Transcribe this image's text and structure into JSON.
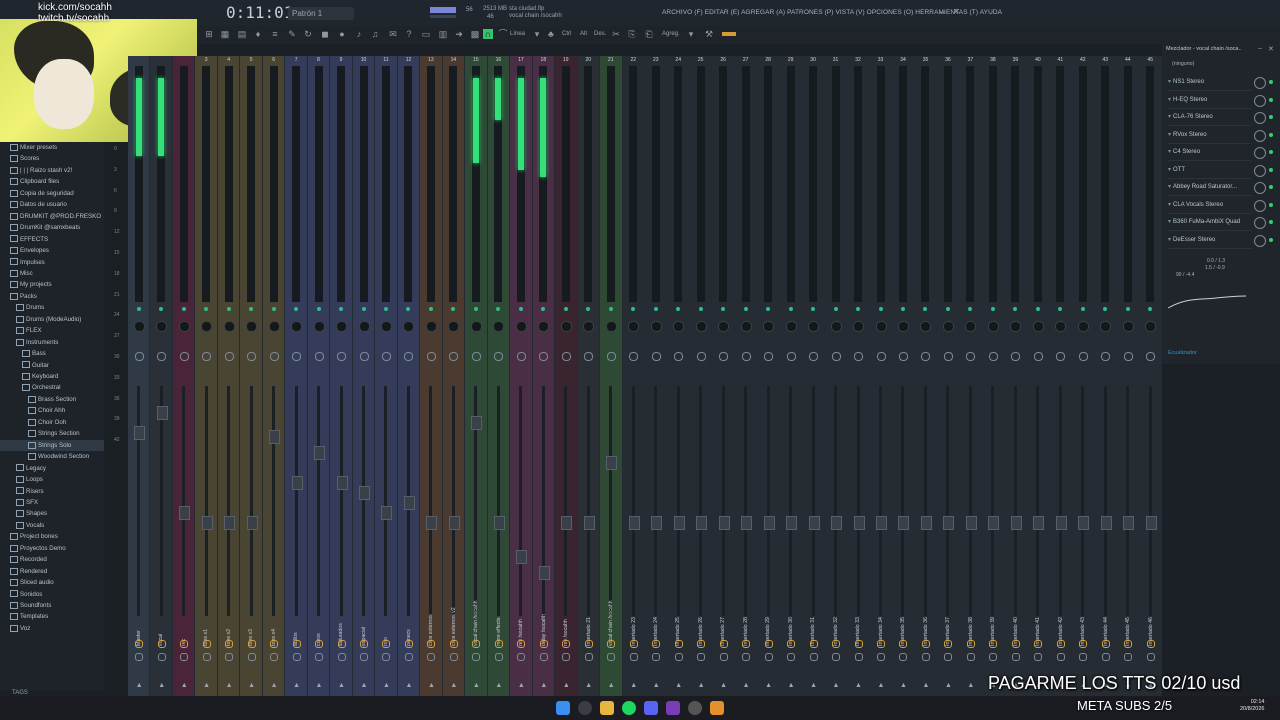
{
  "stream": {
    "kick_url": "kick.com/socahh",
    "twitch_url": "twitch.tv/socahh",
    "tts_banner": "PAGARME LOS TTS 02/10 usd",
    "subs_banner": "META SUBS 2/5"
  },
  "topbar": {
    "time": "0:11:01",
    "pattern": "Patrón 1",
    "tempo": "56",
    "memory": "2513 MB",
    "cpu": "46",
    "project_file": "sta ciudad.flp",
    "project_mixer": "vocal chain /socahh",
    "menu": "ARCHIVO (F) EDITAR (E) AGREGAR (A) PATRONES (P) VISTA (V) OPCIONES (O) HERRAMIENTAS (T) AYUDA",
    "linea_label": "Línea",
    "agreg_label": "Agreg.",
    "ctrl_label": "Ctrl",
    "alt_label": "Alt",
    "des_label": "Des."
  },
  "browser": {
    "items": [
      {
        "label": "Mixer presets",
        "indent": 1
      },
      {
        "label": "Scores",
        "indent": 1
      },
      {
        "label": "| | | Raizo stash v2!",
        "indent": 1
      },
      {
        "label": "Clipboard files",
        "indent": 1
      },
      {
        "label": "Copia de seguridad",
        "indent": 1
      },
      {
        "label": "Datos de usuario",
        "indent": 1
      },
      {
        "label": "DRUMKIT @PROD.FRESKO",
        "indent": 1
      },
      {
        "label": "DrumKit @samxbeats",
        "indent": 1
      },
      {
        "label": "EFFECTS",
        "indent": 1
      },
      {
        "label": "Envelopes",
        "indent": 1
      },
      {
        "label": "Impulses",
        "indent": 1
      },
      {
        "label": "Misc",
        "indent": 1
      },
      {
        "label": "My projects",
        "indent": 1
      },
      {
        "label": "Packs",
        "indent": 1
      },
      {
        "label": "Drums",
        "indent": 2
      },
      {
        "label": "Drums (ModeAudio)",
        "indent": 2
      },
      {
        "label": "FLEX",
        "indent": 2
      },
      {
        "label": "Instruments",
        "indent": 2
      },
      {
        "label": "Bass",
        "indent": 3
      },
      {
        "label": "Guitar",
        "indent": 3
      },
      {
        "label": "Keyboard",
        "indent": 3
      },
      {
        "label": "Orchestral",
        "indent": 3
      },
      {
        "label": "Brass Section",
        "indent": 4
      },
      {
        "label": "Choir Ahh",
        "indent": 4
      },
      {
        "label": "Choir Ooh",
        "indent": 4
      },
      {
        "label": "Strings Section",
        "indent": 4
      },
      {
        "label": "Strings Solo",
        "indent": 4
      },
      {
        "label": "Woodwind Section",
        "indent": 4
      },
      {
        "label": "Legacy",
        "indent": 2
      },
      {
        "label": "Loops",
        "indent": 2
      },
      {
        "label": "Risers",
        "indent": 2
      },
      {
        "label": "SFX",
        "indent": 2
      },
      {
        "label": "Shapes",
        "indent": 2
      },
      {
        "label": "Vocals",
        "indent": 2
      },
      {
        "label": "Project bones",
        "indent": 1
      },
      {
        "label": "Proyectos Demo",
        "indent": 1
      },
      {
        "label": "Recorded",
        "indent": 1
      },
      {
        "label": "Rendered",
        "indent": 1
      },
      {
        "label": "Sliced audio",
        "indent": 1
      },
      {
        "label": "Sonidos",
        "indent": 1
      },
      {
        "label": "Soundfonts",
        "indent": 1
      },
      {
        "label": "Templates",
        "indent": 1
      },
      {
        "label": "Voz",
        "indent": 1
      }
    ],
    "tag": "TAGS"
  },
  "scale": [
    "0",
    "3",
    "6",
    "9",
    "12",
    "15",
    "18",
    "21",
    "24",
    "27",
    "30",
    "33",
    "36",
    "39",
    "42"
  ],
  "mixer": {
    "strips": [
      {
        "num": "",
        "name": "Master",
        "color": "#2f3a46",
        "level": 0.55,
        "fader": 0.2
      },
      {
        "num": "",
        "name": "vocal",
        "color": "#2a3037",
        "level": 0.55,
        "fader": 0.1
      },
      {
        "num": "",
        "name": "rec",
        "color": "#4a2438",
        "level": 0.0,
        "fader": 0.6
      },
      {
        "num": "3",
        "name": "tone x1",
        "color": "#4a4433",
        "level": 0,
        "fader": 0.65
      },
      {
        "num": "4",
        "name": "tone x2",
        "color": "#4a4433",
        "level": 0,
        "fader": 0.65
      },
      {
        "num": "5",
        "name": "tone x3",
        "color": "#4a4433",
        "level": 0,
        "fader": 0.65
      },
      {
        "num": "6",
        "name": "tone x4",
        "color": "#4a4433",
        "level": 0,
        "fader": 0.22
      },
      {
        "num": "7",
        "name": "adlibs",
        "color": "#353c5a",
        "level": 0,
        "fader": 0.45
      },
      {
        "num": "8",
        "name": "coros",
        "color": "#353c5a",
        "level": 0,
        "fader": 0.3
      },
      {
        "num": "9",
        "name": "saturados",
        "color": "#353c5a",
        "level": 0,
        "fader": 0.45
      },
      {
        "num": "10",
        "name": "espacial",
        "color": "#353c5a",
        "level": 0,
        "fader": 0.5
      },
      {
        "num": "11",
        "name": "roto",
        "color": "#353c5a",
        "level": 0,
        "fader": 0.6
      },
      {
        "num": "12",
        "name": "panecs",
        "color": "#353c5a",
        "level": 0,
        "fader": 0.55
      },
      {
        "num": "13",
        "name": "clips externos",
        "color": "#4a3a30",
        "level": 0,
        "fader": 0.65
      },
      {
        "num": "14",
        "name": "clips externos v2",
        "color": "#4a3a30",
        "level": 0,
        "fader": 0.65
      },
      {
        "num": "15",
        "name": "vocal chain /socahh",
        "color": "#2e4a36",
        "level": 0.6,
        "fader": 0.15
      },
      {
        "num": "16",
        "name": "more effects",
        "color": "#2e4a36",
        "level": 0.3,
        "fader": 0.65
      },
      {
        "num": "17",
        "name": "rev /socahh",
        "color": "#4a2e46",
        "level": 0.65,
        "fader": 0.82
      },
      {
        "num": "18",
        "name": "delay /socahh",
        "color": "#4a2e46",
        "level": 0.7,
        "fader": 0.9
      },
      {
        "num": "19",
        "name": "rev /socahh",
        "color": "#3a2430",
        "level": 0,
        "fader": 0.65
      },
      {
        "num": "20",
        "name": "Insertado 21",
        "color": "#2a2f36",
        "level": 0,
        "fader": 0.65
      },
      {
        "num": "21",
        "name": "vocal chain /socahh",
        "color": "#2f4a34",
        "level": 0,
        "fader": 0.35
      },
      {
        "num": "22",
        "name": "Insertado 23",
        "color": "#262c33",
        "level": 0,
        "fader": 0.65
      },
      {
        "num": "23",
        "name": "Insertado 24",
        "color": "#262c33",
        "level": 0,
        "fader": 0.65
      },
      {
        "num": "24",
        "name": "Insertado 25",
        "color": "#262c33",
        "level": 0,
        "fader": 0.65
      },
      {
        "num": "25",
        "name": "Insertado 26",
        "color": "#262c33",
        "level": 0,
        "fader": 0.65
      },
      {
        "num": "26",
        "name": "Insertado 27",
        "color": "#262c33",
        "level": 0,
        "fader": 0.65
      },
      {
        "num": "27",
        "name": "Insertado 28",
        "color": "#262c33",
        "level": 0,
        "fader": 0.65
      },
      {
        "num": "28",
        "name": "Insertado 29",
        "color": "#262c33",
        "level": 0,
        "fader": 0.65
      },
      {
        "num": "29",
        "name": "Insertado 30",
        "color": "#262c33",
        "level": 0,
        "fader": 0.65
      },
      {
        "num": "30",
        "name": "Insertado 31",
        "color": "#262c33",
        "level": 0,
        "fader": 0.65
      },
      {
        "num": "31",
        "name": "Insertado 32",
        "color": "#262c33",
        "level": 0,
        "fader": 0.65
      },
      {
        "num": "32",
        "name": "Insertado 33",
        "color": "#262c33",
        "level": 0,
        "fader": 0.65
      },
      {
        "num": "33",
        "name": "Insertado 34",
        "color": "#262c33",
        "level": 0,
        "fader": 0.65
      },
      {
        "num": "34",
        "name": "Insertado 35",
        "color": "#262c33",
        "level": 0,
        "fader": 0.65
      },
      {
        "num": "35",
        "name": "Insertado 36",
        "color": "#262c33",
        "level": 0,
        "fader": 0.65
      },
      {
        "num": "36",
        "name": "Insertado 37",
        "color": "#262c33",
        "level": 0,
        "fader": 0.65
      },
      {
        "num": "37",
        "name": "Insertado 38",
        "color": "#262c33",
        "level": 0,
        "fader": 0.65
      },
      {
        "num": "38",
        "name": "Insertado 39",
        "color": "#262c33",
        "level": 0,
        "fader": 0.65
      },
      {
        "num": "39",
        "name": "Insertado 40",
        "color": "#262c33",
        "level": 0,
        "fader": 0.65
      },
      {
        "num": "40",
        "name": "Insertado 41",
        "color": "#262c33",
        "level": 0,
        "fader": 0.65
      },
      {
        "num": "41",
        "name": "Insertado 42",
        "color": "#262c33",
        "level": 0,
        "fader": 0.65
      },
      {
        "num": "42",
        "name": "Insertado 43",
        "color": "#262c33",
        "level": 0,
        "fader": 0.65
      },
      {
        "num": "43",
        "name": "Insertado 44",
        "color": "#262c33",
        "level": 0,
        "fader": 0.65
      },
      {
        "num": "44",
        "name": "Insertado 45",
        "color": "#262c33",
        "level": 0,
        "fader": 0.65
      },
      {
        "num": "45",
        "name": "Insertado 46",
        "color": "#262c33",
        "level": 0,
        "fader": 0.65
      }
    ]
  },
  "fx_panel": {
    "title": "Mezclador - vocal chain /soca..",
    "input": "(ninguno)",
    "slots": [
      "NS1 Stereo",
      "H-EQ Stereo",
      "CLA-76 Stereo",
      "RVox Stereo",
      "C4 Stereo",
      "OTT",
      "Abbey Road Saturator...",
      "CLA Vocals Stereo",
      "B360 FuMa-AmbiX Quad",
      "DeEsser Stereo"
    ],
    "readout1": "0.0 / 1.3",
    "readout2": "1.5 / -0.9",
    "readout3": "90 / -4.4",
    "eq_label": "Ecualizador"
  },
  "taskbar": {
    "time": "02:14",
    "date": "20/8/2026"
  }
}
